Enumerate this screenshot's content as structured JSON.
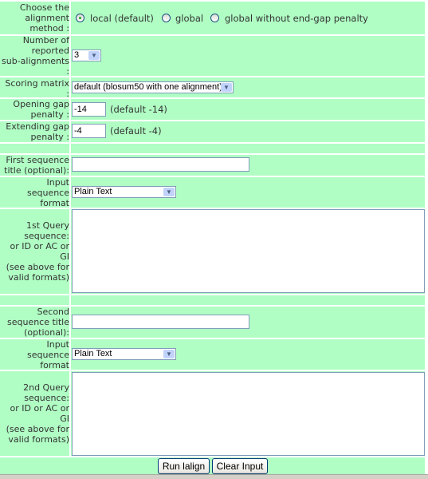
{
  "alignment_method": {
    "label": [
      "Choose the",
      "alignment",
      "method :"
    ],
    "options": [
      {
        "label": "local (default)",
        "selected": true
      },
      {
        "label": "global",
        "selected": false
      },
      {
        "label": "global without end-gap penalty",
        "selected": false
      }
    ]
  },
  "sub_alignments": {
    "label": [
      "Number of",
      "reported",
      "sub-alignments",
      ":"
    ],
    "value": "3"
  },
  "scoring_matrix": {
    "label": [
      "Scoring matrix",
      ":"
    ],
    "value": "default (blosum50 with one alignment)"
  },
  "opening_gap": {
    "label": [
      "Opening gap",
      "penalty :"
    ],
    "value": "-14",
    "hint": "(default -14)"
  },
  "extending_gap": {
    "label": [
      "Extending gap",
      "penalty :"
    ],
    "value": "-4",
    "hint": "(default -4)"
  },
  "first_title": {
    "label": [
      "First sequence",
      "title (optional):"
    ],
    "value": ""
  },
  "first_format": {
    "label": [
      "Input",
      "sequence",
      "format"
    ],
    "value": "Plain Text"
  },
  "first_query": {
    "label": [
      "1st Query",
      "sequence:",
      "or ID or AC or",
      "GI",
      "(see above for",
      "valid formats)"
    ],
    "value": ""
  },
  "second_title": {
    "label": [
      "Second",
      "sequence title",
      "(optional):"
    ],
    "value": ""
  },
  "second_format": {
    "label": [
      "Input",
      "sequence",
      "format"
    ],
    "value": "Plain Text"
  },
  "second_query": {
    "label": [
      "2nd Query",
      "sequence:",
      "or ID or AC or",
      "GI",
      "(see above for",
      "valid formats)"
    ],
    "value": ""
  },
  "buttons": {
    "run": "Run lalign",
    "clear": "Clear Input"
  },
  "colors": {
    "row_background": "#b0fec4",
    "input_border": "#7f9db9"
  }
}
